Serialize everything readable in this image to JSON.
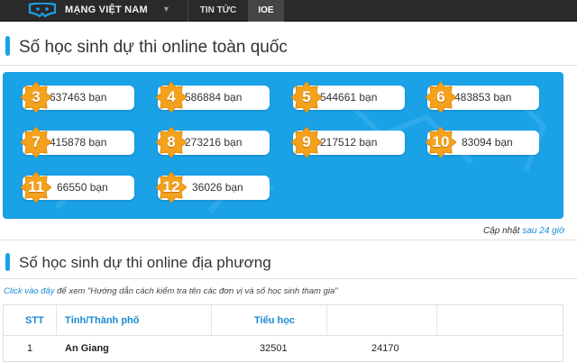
{
  "topbar": {
    "brand": "MẠNG VIỆT NAM",
    "nav": [
      "TIN TỨC",
      "IOE"
    ],
    "active_nav": "IOE"
  },
  "national": {
    "title": "Số học sinh dự thi online toàn quốc",
    "grades": [
      {
        "grade": "3",
        "count": "637463 bạn"
      },
      {
        "grade": "4",
        "count": "586884 bạn"
      },
      {
        "grade": "5",
        "count": "544661 bạn"
      },
      {
        "grade": "6",
        "count": "483853 bạn"
      },
      {
        "grade": "7",
        "count": "415878 bạn"
      },
      {
        "grade": "8",
        "count": "273216 bạn"
      },
      {
        "grade": "9",
        "count": "217512 bạn"
      },
      {
        "grade": "10",
        "count": "83094 bạn"
      },
      {
        "grade": "11",
        "count": "66550 bạn"
      },
      {
        "grade": "12",
        "count": "36026 bạn"
      }
    ],
    "updated_prefix": "Cập nhật",
    "updated_link": "sau 24 giờ"
  },
  "local": {
    "title": "Số học sinh dự thi online địa phương",
    "hint_link": "Click vào đây",
    "hint_text": "để xem \"Hướng dẫn cách kiểm tra tên các đơn vị và số học sinh tham gia\"",
    "table": {
      "headers": [
        "STT",
        "Tỉnh/Thành phố",
        "Tiểu học"
      ],
      "rows": [
        {
          "stt": "1",
          "province": "An Giang",
          "primary": "32501",
          "secondary": "24170"
        }
      ]
    }
  },
  "colors": {
    "accent_blue": "#1aa1e6",
    "badge_orange": "#f4a21c",
    "topbar": "#2a2a2a"
  }
}
